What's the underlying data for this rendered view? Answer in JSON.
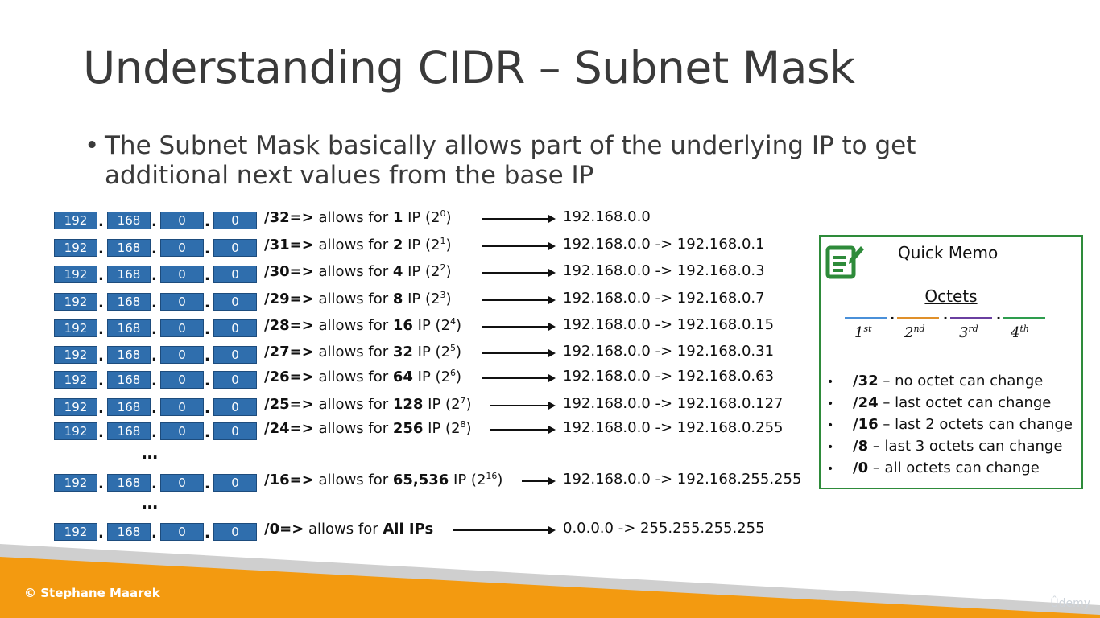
{
  "title": "Understanding CIDR – Subnet Mask",
  "bullet": {
    "mark": "•",
    "text": "The Subnet Mask basically allows part of the underlying IP to get additional next values from the base IP"
  },
  "octets": [
    "192",
    "168",
    "0",
    "0"
  ],
  "separator": ".",
  "rows": [
    {
      "cidr": "/32",
      "arrow": "=>",
      "mid": " allows for ",
      "count": "1",
      "ip": " IP (",
      "base": "2",
      "exp": "0",
      "close": ")",
      "range": "192.168.0.0"
    },
    {
      "cidr": "/31",
      "arrow": "=>",
      "mid": " allows for ",
      "count": "2",
      "ip": " IP (",
      "base": "2",
      "exp": "1",
      "close": ")",
      "range": "192.168.0.0 -> 192.168.0.1"
    },
    {
      "cidr": "/30",
      "arrow": "=>",
      "mid": " allows for ",
      "count": "4",
      "ip": " IP (",
      "base": "2",
      "exp": "2",
      "close": ")",
      "range": "192.168.0.0 -> 192.168.0.3"
    },
    {
      "cidr": "/29",
      "arrow": "=>",
      "mid": " allows for ",
      "count": "8",
      "ip": " IP (",
      "base": "2",
      "exp": "3",
      "close": ")",
      "range": "192.168.0.0 -> 192.168.0.7"
    },
    {
      "cidr": "/28",
      "arrow": "=>",
      "mid": " allows for ",
      "count": "16",
      "ip": " IP (",
      "base": "2",
      "exp": "4",
      "close": ")",
      "range": "192.168.0.0 -> 192.168.0.15"
    },
    {
      "cidr": "/27",
      "arrow": "=>",
      "mid": " allows for ",
      "count": "32",
      "ip": " IP (",
      "base": "2",
      "exp": "5",
      "close": ")",
      "range": "192.168.0.0 -> 192.168.0.31"
    },
    {
      "cidr": "/26",
      "arrow": "=>",
      "mid": " allows for ",
      "count": "64",
      "ip": " IP (",
      "base": "2",
      "exp": "6",
      "close": ")",
      "range": "192.168.0.0 -> 192.168.0.63"
    },
    {
      "cidr": "/25",
      "arrow": "=>",
      "mid": " allows for ",
      "count": "128",
      "ip": " IP (",
      "base": "2",
      "exp": "7",
      "close": ")",
      "range": "192.168.0.0 -> 192.168.0.127"
    },
    {
      "cidr": "/24",
      "arrow": "=>",
      "mid": " allows for ",
      "count": "256",
      "ip": " IP (",
      "base": "2",
      "exp": "8",
      "close": ")",
      "range": "192.168.0.0 -> 192.168.0.255"
    },
    {
      "cidr": "/16",
      "arrow": "=>",
      "mid": " allows for ",
      "count": "65,536",
      "ip": " IP (",
      "base": "2",
      "exp": "16",
      "close": ")",
      "range": "192.168.0.0 -> 192.168.255.255"
    },
    {
      "cidr": "/0",
      "arrow": "=>",
      "mid": " allows for ",
      "count": "All IPs",
      "ip": "",
      "base": "",
      "exp": "",
      "close": "",
      "range": "0.0.0.0 -> 255.255.255.255"
    }
  ],
  "ellipsis": "…",
  "memo": {
    "title": "Quick Memo",
    "icon": "notepad-edit-icon",
    "octets_title": "Octets",
    "octet_labels": [
      {
        "num": "1",
        "suffix": "st"
      },
      {
        "num": "2",
        "suffix": "nd"
      },
      {
        "num": "3",
        "suffix": "rd"
      },
      {
        "num": "4",
        "suffix": "th"
      }
    ],
    "octet_colors": [
      "#4a90d9",
      "#e0902a",
      "#6a3fa0",
      "#2e9d4e"
    ],
    "items": [
      {
        "bullet": "•",
        "key": "/32",
        "text": " – no octet can change"
      },
      {
        "bullet": "•",
        "key": "/24",
        "text": " – last octet can change"
      },
      {
        "bullet": "•",
        "key": "/16",
        "text": " – last 2 octets can change"
      },
      {
        "bullet": "•",
        "key": "/8",
        "text": " – last 3 octets can change"
      },
      {
        "bullet": "•",
        "key": "/0",
        "text": " – all octets can change"
      }
    ]
  },
  "footer": {
    "copyright": "© Stephane Maarek",
    "brand": "Ûdemy"
  },
  "colors": {
    "octet_box": "#2f6ead",
    "memo_border": "#2e8b3a",
    "footer_orange": "#f39a10",
    "footer_gray": "#cfcfcf"
  }
}
